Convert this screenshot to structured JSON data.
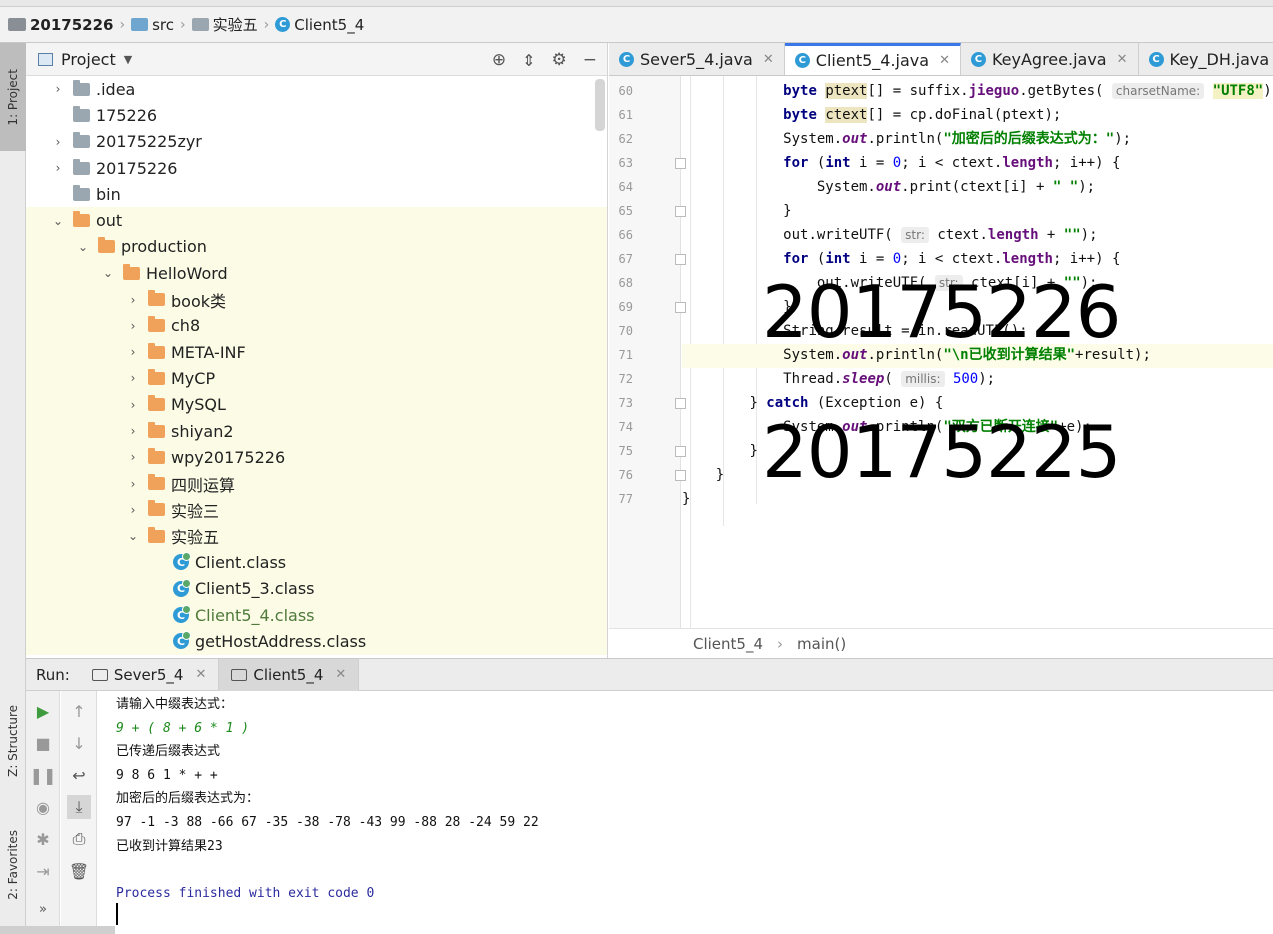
{
  "breadcrumb": {
    "project": "20175226",
    "src": "src",
    "pkg": "实验五",
    "file": "Client5_4"
  },
  "left_strip": {
    "project_tab": "1: Project",
    "structure_tab": "Z: Structure",
    "favorites_tab": "2: Favorites"
  },
  "project_panel": {
    "title": "Project",
    "tree": [
      {
        "label": ".idea",
        "arrow": "›",
        "icon": "gray"
      },
      {
        "label": "175226",
        "arrow": "",
        "icon": "gray"
      },
      {
        "label": "20175225zyr",
        "arrow": "›",
        "icon": "gray"
      },
      {
        "label": "20175226",
        "arrow": "›",
        "icon": "gray"
      },
      {
        "label": "bin",
        "arrow": "",
        "icon": "gray"
      },
      {
        "label": "out",
        "arrow": "⌄",
        "icon": "orange"
      },
      {
        "label": "production",
        "arrow": "⌄",
        "icon": "orange"
      },
      {
        "label": "HelloWord",
        "arrow": "⌄",
        "icon": "orange"
      },
      {
        "label": "book类",
        "arrow": "›",
        "icon": "orange"
      },
      {
        "label": "ch8",
        "arrow": "›",
        "icon": "orange"
      },
      {
        "label": "META-INF",
        "arrow": "›",
        "icon": "orange"
      },
      {
        "label": "MyCP",
        "arrow": "›",
        "icon": "orange"
      },
      {
        "label": "MySQL",
        "arrow": "›",
        "icon": "orange"
      },
      {
        "label": "shiyan2",
        "arrow": "›",
        "icon": "orange"
      },
      {
        "label": "wpy20175226",
        "arrow": "›",
        "icon": "orange"
      },
      {
        "label": "四则运算",
        "arrow": "›",
        "icon": "orange"
      },
      {
        "label": "实验三",
        "arrow": "›",
        "icon": "orange"
      },
      {
        "label": "实验五",
        "arrow": "⌄",
        "icon": "orange"
      },
      {
        "label": "Client.class",
        "arrow": "",
        "icon": "class"
      },
      {
        "label": "Client5_3.class",
        "arrow": "",
        "icon": "class"
      },
      {
        "label": "Client5_4.class",
        "arrow": "",
        "icon": "class"
      },
      {
        "label": "getHostAddress.class",
        "arrow": "",
        "icon": "class"
      }
    ]
  },
  "editor": {
    "tabs": [
      {
        "label": "Sever5_4.java",
        "active": false
      },
      {
        "label": "Client5_4.java",
        "active": true
      },
      {
        "label": "KeyAgree.java",
        "active": false
      },
      {
        "label": "Key_DH.java",
        "active": false
      }
    ],
    "line_numbers": [
      "60",
      "61",
      "62",
      "63",
      "64",
      "65",
      "66",
      "67",
      "68",
      "69",
      "70",
      "71",
      "72",
      "73",
      "74",
      "75",
      "76",
      "77"
    ],
    "code": {
      "l60_a": "byte ",
      "l60_var": "ptext",
      "l60_b": "[] = suffix.",
      "l60_field": "jieguo",
      "l60_c": ".getBytes( ",
      "l60_hint": "charsetName:",
      "l60_str": "\"UTF8\"",
      "l60_d": ");",
      "l61_a": "byte ",
      "l61_var": "ctext",
      "l61_b": "[] = cp.doFinal(ptext);",
      "l62_a": "System.",
      "l62_out": "out",
      "l62_b": ".println(",
      "l62_str": "\"加密后的后缀表达式为：\"",
      "l62_c": ");",
      "l63_kw": "for",
      "l63_a": " (",
      "l63_kw2": "int",
      "l63_b": " i = ",
      "l63_n": "0",
      "l63_c": "; i < ctext.",
      "l63_f": "length",
      "l63_d": "; i++) {",
      "l64_a": "System.",
      "l64_out": "out",
      "l64_b": ".print(ctext[i] + ",
      "l64_str": "\" \"",
      "l64_c": ");",
      "l65": "}",
      "l66_a": "out.writeUTF( ",
      "l66_hint": "str:",
      "l66_b": " ctext.",
      "l66_f": "length",
      "l66_c": " + ",
      "l66_str": "\"\"",
      "l66_d": ");",
      "l67_kw": "for",
      "l67_a": " (",
      "l67_kw2": "int",
      "l67_b": " i = ",
      "l67_n": "0",
      "l67_c": "; i < ctext.",
      "l67_f": "length",
      "l67_d": "; i++) {",
      "l68_a": "out.writeUTF( ",
      "l68_hint": "str:",
      "l68_b": " ctext[i] + ",
      "l68_str": "\"\"",
      "l68_c": ");",
      "l69": "}",
      "l70_a": "String result = in.readUTF();",
      "l71_a": "System.",
      "l71_out": "out",
      "l71_b": ".println(",
      "l71_str": "\"\\n已收到计算结果\"",
      "l71_c": "+result);",
      "l72_a": "Thread.",
      "l72_sleep": "sleep",
      "l72_b": "( ",
      "l72_hint": "millis:",
      "l72_n": " 500",
      "l72_c": ");",
      "l73_a": "} ",
      "l73_kw": "catch",
      "l73_b": " (Exception e) {",
      "l74_a": "System.",
      "l74_out": "out",
      "l74_b": ".println(",
      "l74_str": "\"双方已断开连接\"",
      "l74_c": "+e);",
      "l75": "}",
      "l76": "}",
      "l77": "}"
    },
    "overlay_1": "20175226",
    "overlay_2": "20175225",
    "breadcrumb_class": "Client5_4",
    "breadcrumb_method": "main()"
  },
  "run_panel": {
    "label": "Run:",
    "tabs": [
      {
        "label": "Sever5_4",
        "active": false
      },
      {
        "label": "Client5_4",
        "active": true
      }
    ],
    "console": [
      {
        "text": "请输入中缀表达式：",
        "kind": "out"
      },
      {
        "text": "9 + ( 8 + 6 * 1 )",
        "kind": "input"
      },
      {
        "text": "已传递后缀表达式",
        "kind": "out"
      },
      {
        "text": "9 8 6 1 * + +",
        "kind": "out"
      },
      {
        "text": "加密后的后缀表达式为：",
        "kind": "out"
      },
      {
        "text": "97 -1 -3 88 -66 67 -35 -38 -78 -43 99 -88 28 -24 59 22",
        "kind": "out"
      },
      {
        "text": "已收到计算结果23",
        "kind": "out"
      },
      {
        "text": "",
        "kind": "out"
      },
      {
        "text": "Process finished with exit code 0",
        "kind": "proc"
      }
    ]
  },
  "colors": {
    "accent": "#3b78e7",
    "folder_orange": "#f0a25a",
    "folder_gray": "#9aa7b0",
    "class_blue": "#2f9bd6",
    "keyword": "#000080",
    "string": "#008000"
  }
}
